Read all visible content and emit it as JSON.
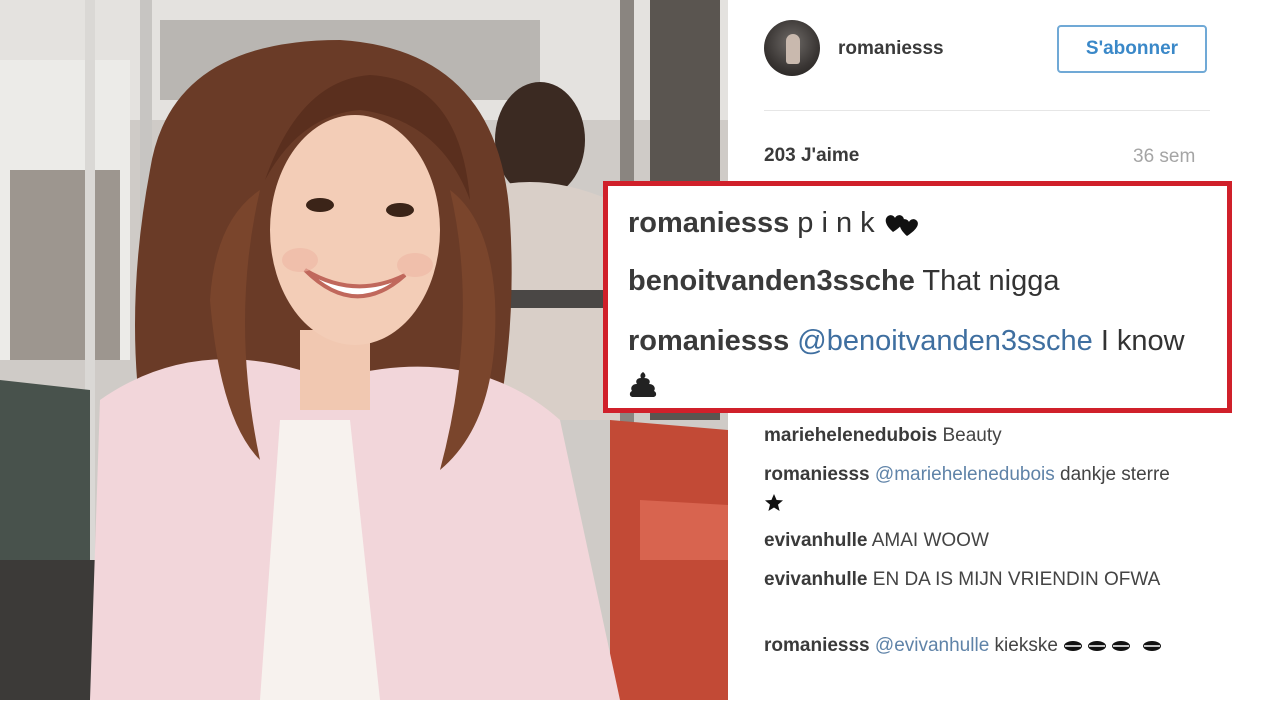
{
  "post": {
    "username": "romaniesss",
    "follow_label": "S'abonner",
    "likes": "203 J'aime",
    "age": "36 sem"
  },
  "highlighted_comments": [
    {
      "user": "romaniesss",
      "text": "p i n k",
      "emoji": "two-hearts-icon"
    },
    {
      "user": "benoitvanden3ssche",
      "text": "That nigga"
    },
    {
      "user": "romaniesss",
      "mention": "@benoitvanden3ssche",
      "text": "I know",
      "emoji": "poop-icon"
    }
  ],
  "comments": [
    {
      "user": "mariehelenedubois",
      "text": "Beauty"
    },
    {
      "user": "romaniesss",
      "mention": "@mariehelenedubois",
      "text": "dankje sterre",
      "emoji": "star-icon"
    },
    {
      "user": "evivanhulle",
      "text": "AMAI WOOW"
    },
    {
      "user": "evivanhulle",
      "text": "EN DA IS MIJN VRIENDIN OFWA"
    },
    {
      "user": "romaniesss",
      "mention": "@evivanhulle",
      "text": "kiekske",
      "emoji": "kiss-mark-icon"
    }
  ],
  "colors": {
    "highlight_border": "#d0202a",
    "follow_button": "#3a88c8",
    "mention": "#3f6fa0"
  }
}
